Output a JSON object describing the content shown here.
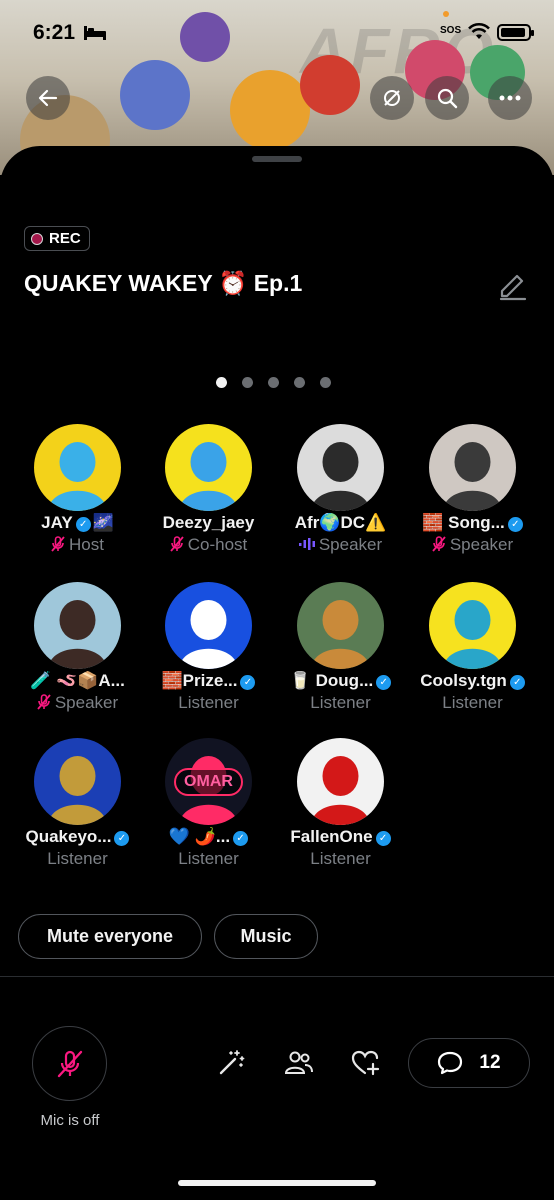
{
  "status_bar": {
    "time": "6:21",
    "sos": "SOS"
  },
  "header": {
    "icons": [
      "back-arrow-icon",
      "no-location-icon",
      "search-icon",
      "more-icon"
    ]
  },
  "space": {
    "rec_label": "REC",
    "title": "QUAKEY WAKEY ⏰ Ep.1",
    "pager": {
      "count": 5,
      "active": 0
    }
  },
  "participants": [
    {
      "name": "JAY",
      "verified": true,
      "suffix": "🌌",
      "role": "Host",
      "mic": "off",
      "avatar_bg": "#f3d21a",
      "avatar_fg": "#3ab0e8"
    },
    {
      "name": "Deezy_jaey",
      "verified": false,
      "suffix": "",
      "role": "Co-host",
      "mic": "off",
      "avatar_bg": "#f5e11d",
      "avatar_fg": "#3aa3e8"
    },
    {
      "name": "Afr🌍DC⚠️",
      "verified": false,
      "suffix": "",
      "role": "Speaker",
      "mic": "speaking",
      "avatar_bg": "#dcdcdc",
      "avatar_fg": "#2b2b2b"
    },
    {
      "name": "🧱 Song...",
      "verified": true,
      "suffix": "",
      "role": "Speaker",
      "mic": "off",
      "avatar_bg": "#cfc8c2",
      "avatar_fg": "#3a3a3a"
    },
    {
      "name": "🧪 🪱📦A...",
      "verified": false,
      "suffix": "",
      "role": "Speaker",
      "mic": "off",
      "avatar_bg": "#9fc7da",
      "avatar_fg": "#3d2a25"
    },
    {
      "name": "🧱Prize...",
      "verified": true,
      "suffix": "",
      "role": "Listener",
      "mic": "none",
      "avatar_bg": "#1850e0",
      "avatar_fg": "#ffffff"
    },
    {
      "name": "🥛 Doug...",
      "verified": true,
      "suffix": "",
      "role": "Listener",
      "mic": "none",
      "avatar_bg": "#5a7c54",
      "avatar_fg": "#c98a3a"
    },
    {
      "name": "Coolsy.tgn",
      "verified": true,
      "suffix": "",
      "role": "Listener",
      "mic": "none",
      "avatar_bg": "#f6e21f",
      "avatar_fg": "#29a6c9"
    },
    {
      "name": "Quakeyo...",
      "verified": true,
      "suffix": "",
      "role": "Listener",
      "mic": "none",
      "avatar_bg": "#1b3fb5",
      "avatar_fg": "#c29b3a"
    },
    {
      "name": "💙 🌶️...",
      "verified": true,
      "suffix": "",
      "role": "Listener",
      "mic": "none",
      "avatar_bg": "#111322",
      "avatar_fg": "#ff2b66"
    },
    {
      "name": "FallenOne",
      "verified": true,
      "suffix": "",
      "role": "Listener",
      "mic": "none",
      "avatar_bg": "#f2f2f2",
      "avatar_fg": "#d31818"
    }
  ],
  "avatar_text": {
    "omar": "OMAR"
  },
  "actions": {
    "mute_everyone": "Mute everyone",
    "music": "Music"
  },
  "controls": {
    "mic_label": "Mic is off",
    "comment_count": "12"
  },
  "colors": {
    "accent_pink": "#f91880",
    "verified_blue": "#1d9bf0",
    "speaker_purple": "#7856ff"
  }
}
